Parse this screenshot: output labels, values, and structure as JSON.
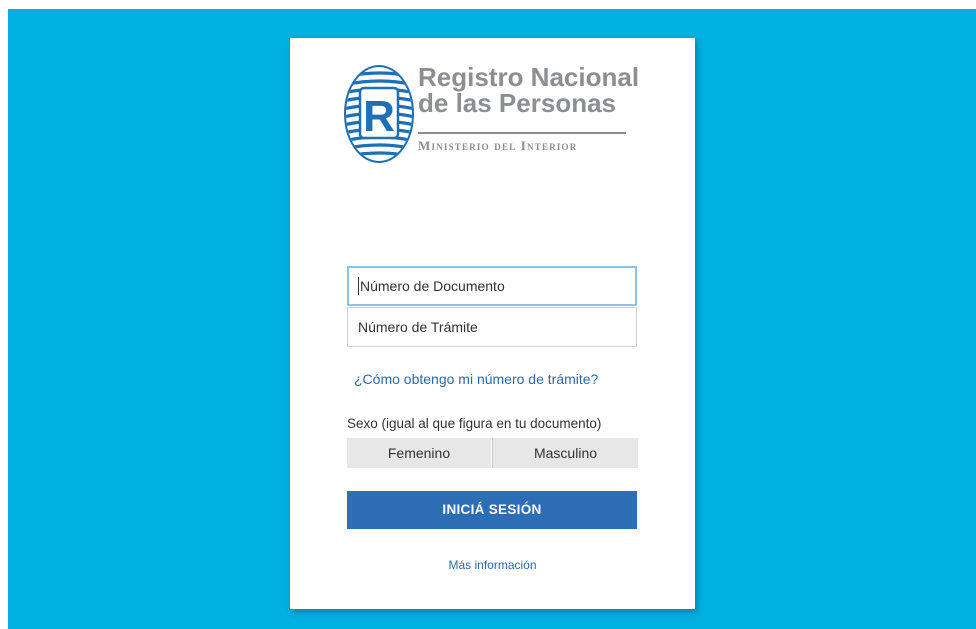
{
  "branding": {
    "title_line1": "Registro Nacional",
    "title_line2": "de las Personas",
    "subtitle": "Ministerio del Interior",
    "logo_letter": "R",
    "accent_color": "#00b0e0",
    "logo_blue": "#1f6fb5",
    "text_gray": "#8b8e92"
  },
  "form": {
    "document_placeholder": "Número de Documento",
    "tramite_placeholder": "Número de Trámite",
    "help_link": "¿Cómo obtengo mi número de trámite?",
    "sex_label": "Sexo (igual al que figura en tu documento)",
    "sex_options": [
      "Femenino",
      "Masculino"
    ],
    "login_button": "INICIÁ SESIÓN",
    "more_info_link": "Más información"
  },
  "colors": {
    "background": "#00b0e0",
    "button": "#2c6db6",
    "link": "#2f6aa8",
    "focus_border": "#8ec3e8"
  }
}
